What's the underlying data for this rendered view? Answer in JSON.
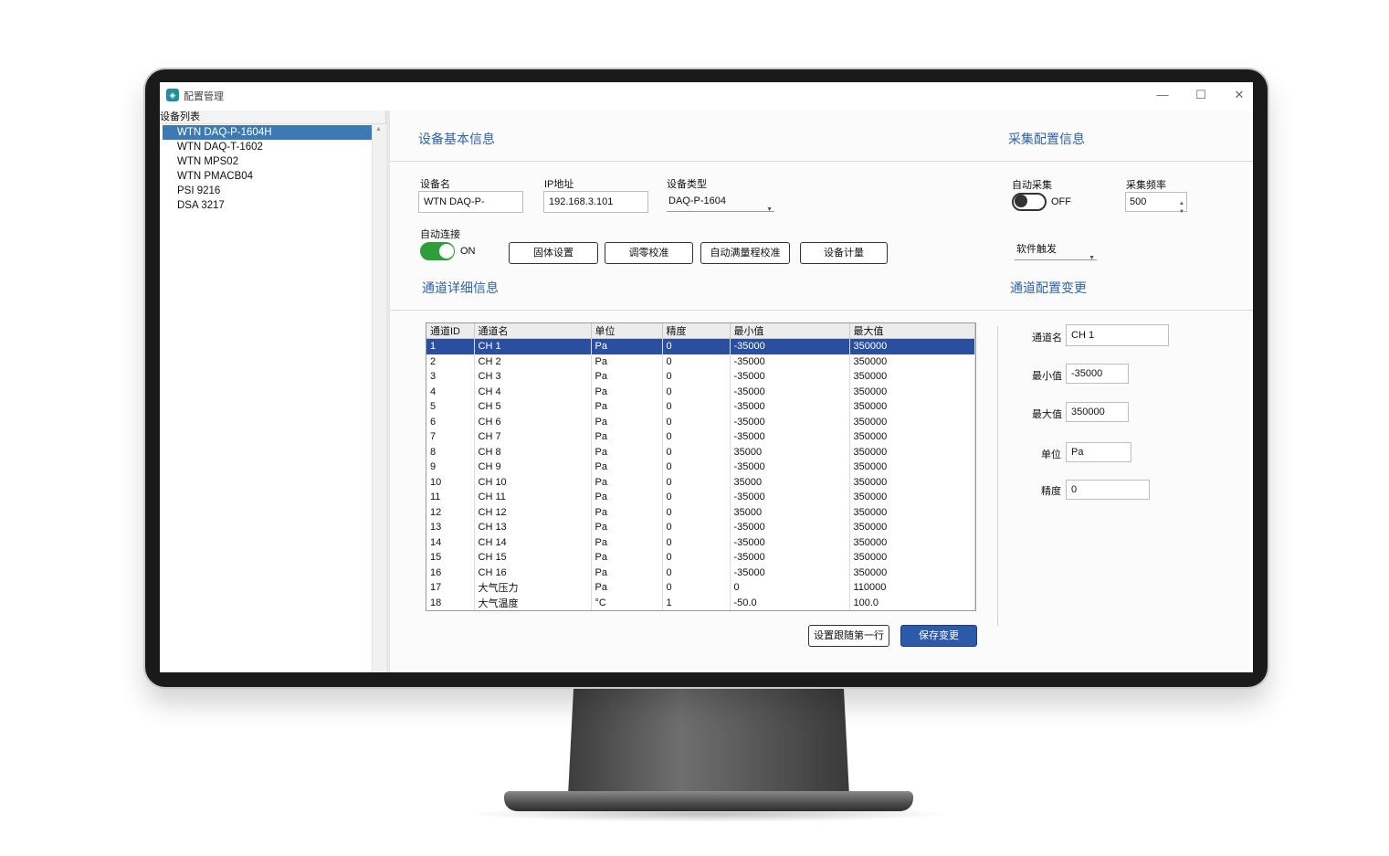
{
  "window": {
    "title": "配置管理",
    "icon": "app-logo-icon",
    "controls": [
      "—",
      "☐",
      "✕"
    ]
  },
  "device_list": {
    "header": "设备列表",
    "items": [
      "WTN DAQ-P-1604H",
      "WTN DAQ-T-1602",
      "WTN MPS02",
      "WTN PMACB04",
      "PSI 9216",
      "DSA 3217"
    ],
    "selected_index": 0
  },
  "basic_info": {
    "title": "设备基本信息",
    "device_name_label": "设备名",
    "device_name_value": "WTN DAQ-P-",
    "ip_label": "IP地址",
    "ip_value": "192.168.3.101",
    "type_label": "设备类型",
    "type_value": "DAQ-P-1604",
    "auto_connect_label": "自动连接",
    "auto_connect_state": "ON",
    "buttons": [
      "固体设置",
      "调零校准",
      "自动满量程校准",
      "设备计量"
    ]
  },
  "acq_config": {
    "title": "采集配置信息",
    "auto_acq_label": "自动采集",
    "auto_acq_state": "OFF",
    "freq_label": "采集频率",
    "freq_value": "500",
    "trigger_value": "软件触发"
  },
  "channel_detail": {
    "title": "通道详细信息",
    "columns": [
      "通道ID",
      "通道名",
      "单位",
      "精度",
      "最小值",
      "最大值"
    ],
    "rows": [
      [
        "1",
        "CH 1",
        "Pa",
        "0",
        "-35000",
        "350000"
      ],
      [
        "2",
        "CH 2",
        "Pa",
        "0",
        "-35000",
        "350000"
      ],
      [
        "3",
        "CH 3",
        "Pa",
        "0",
        "-35000",
        "350000"
      ],
      [
        "4",
        "CH 4",
        "Pa",
        "0",
        "-35000",
        "350000"
      ],
      [
        "5",
        "CH 5",
        "Pa",
        "0",
        "-35000",
        "350000"
      ],
      [
        "6",
        "CH 6",
        "Pa",
        "0",
        "-35000",
        "350000"
      ],
      [
        "7",
        "CH 7",
        "Pa",
        "0",
        "-35000",
        "350000"
      ],
      [
        "8",
        "CH 8",
        "Pa",
        "0",
        "35000",
        "350000"
      ],
      [
        "9",
        "CH 9",
        "Pa",
        "0",
        "-35000",
        "350000"
      ],
      [
        "10",
        "CH 10",
        "Pa",
        "0",
        "35000",
        "350000"
      ],
      [
        "11",
        "CH 11",
        "Pa",
        "0",
        "-35000",
        "350000"
      ],
      [
        "12",
        "CH 12",
        "Pa",
        "0",
        "35000",
        "350000"
      ],
      [
        "13",
        "CH 13",
        "Pa",
        "0",
        "-35000",
        "350000"
      ],
      [
        "14",
        "CH 14",
        "Pa",
        "0",
        "-35000",
        "350000"
      ],
      [
        "15",
        "CH 15",
        "Pa",
        "0",
        "-35000",
        "350000"
      ],
      [
        "16",
        "CH 16",
        "Pa",
        "0",
        "-35000",
        "350000"
      ],
      [
        "17",
        "大气压力",
        "Pa",
        "0",
        "0",
        "110000"
      ],
      [
        "18",
        "大气温度",
        "°C",
        "1",
        "-50.0",
        "100.0"
      ]
    ],
    "selected_index": 0,
    "button_follow": "设置跟随第一行",
    "button_save": "保存变更"
  },
  "channel_edit": {
    "title": "通道配置变更",
    "name_label": "通道名",
    "name_value": "CH 1",
    "min_label": "最小值",
    "min_value": "-35000",
    "max_label": "最大值",
    "max_value": "350000",
    "unit_label": "单位",
    "unit_value": "Pa",
    "precision_label": "精度",
    "precision_value": "0"
  },
  "colors": {
    "accent": "#2f63a8",
    "selection": "#2b4fa0",
    "toggle_on": "#2e9e3a",
    "list_selection": "#3d7ab5"
  }
}
